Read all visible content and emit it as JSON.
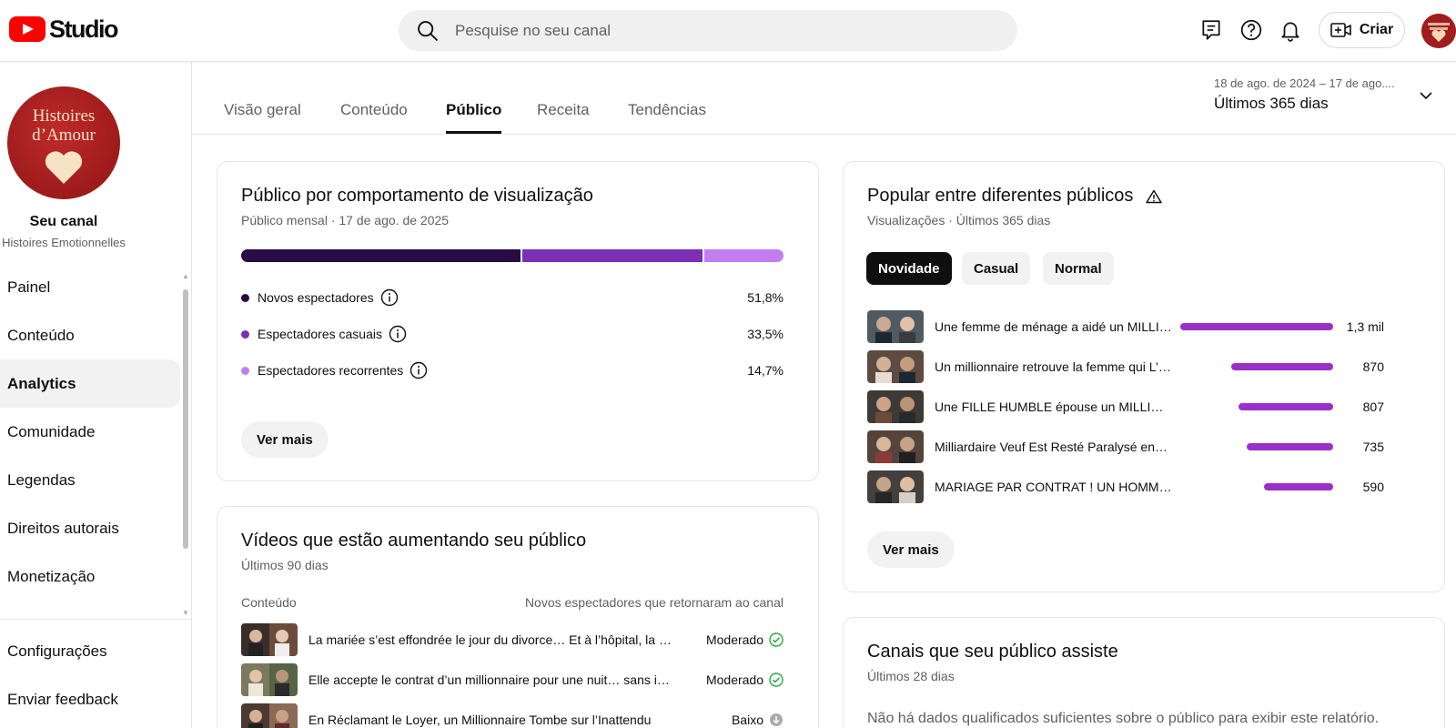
{
  "header": {
    "logo_text": "Studio",
    "search_placeholder": "Pesquise no seu canal",
    "create_label": "Criar",
    "icons": [
      "feedback-icon",
      "help-icon",
      "notifications-icon",
      "create-video-icon"
    ]
  },
  "sidebar": {
    "avatar_line1": "Histoires",
    "avatar_line2": "d’Amour",
    "your_channel": "Seu canal",
    "channel_name": "Histoires Emotionnelles",
    "items": [
      {
        "label": "Painel",
        "active": false
      },
      {
        "label": "Conteúdo",
        "active": false
      },
      {
        "label": "Analytics",
        "active": true
      },
      {
        "label": "Comunidade",
        "active": false
      },
      {
        "label": "Legendas",
        "active": false
      },
      {
        "label": "Direitos autorais",
        "active": false
      },
      {
        "label": "Monetização",
        "active": false
      }
    ],
    "bottom_items": [
      {
        "label": "Configurações"
      },
      {
        "label": "Enviar feedback"
      }
    ]
  },
  "tabs": [
    {
      "label": "Visão geral",
      "active": false
    },
    {
      "label": "Conteúdo",
      "active": false
    },
    {
      "label": "Público",
      "active": true
    },
    {
      "label": "Receita",
      "active": false
    },
    {
      "label": "Tendências",
      "active": false
    }
  ],
  "date_range": {
    "dates": "18 de ago. de 2024 – 17 de ago....",
    "label": "Últimos 365 dias"
  },
  "behavior_card": {
    "title": "Público por comportamento de visualização",
    "subtitle": "Público mensal · 17 de ago. de 2025",
    "segments": [
      {
        "label": "Novos espectadores",
        "value": "51,8%",
        "share": 51.8,
        "color": "#2b0b45"
      },
      {
        "label": "Espectadores casuais",
        "value": "33,5%",
        "share": 33.5,
        "color": "#7b2fb5"
      },
      {
        "label": "Espectadores recorrentes",
        "value": "14,7%",
        "share": 14.7,
        "color": "#c27ef0"
      }
    ],
    "button": "Ver mais"
  },
  "growing_card": {
    "title": "Vídeos que estão aumentando seu público",
    "subtitle": "Últimos 90 dias",
    "col_content": "Conteúdo",
    "col_metric": "Novos espectadores que retornaram ao canal",
    "rows": [
      {
        "title": "La mariée s’est effondrée le jour du divorce… Et à l’hôpital, la vérité…",
        "level": "Moderado",
        "status": "check"
      },
      {
        "title": "Elle accepte le contrat d’un millionnaire pour une nuit… sans imaginer…",
        "level": "Moderado",
        "status": "check"
      },
      {
        "title": "En Réclamant le Loyer, un Millionnaire Tombe sur l’Inattendu",
        "level": "Baixo",
        "status": "down"
      }
    ]
  },
  "popular_card": {
    "title": "Popular entre diferentes públicos",
    "subtitle": "Visualizações · Últimos 365 dias",
    "chips": [
      {
        "label": "Novidade",
        "active": true
      },
      {
        "label": "Casual",
        "active": false
      },
      {
        "label": "Normal",
        "active": false
      }
    ],
    "rows": [
      {
        "title": "Une femme de ménage a aidé un MILLIONNAIRE…",
        "value": "1,3 mil",
        "views": 1300
      },
      {
        "title": "Un millionnaire retrouve la femme qui L’avait…",
        "value": "870",
        "views": 870
      },
      {
        "title": "Une FILLE HUMBLE épouse un MILLIONNAIRE…",
        "value": "807",
        "views": 807
      },
      {
        "title": "Milliardaire Veuf Est Resté Paralysé en…",
        "value": "735",
        "views": 735
      },
      {
        "title": "MARIAGE PAR CONTRAT ! UN HOMME RICHE…",
        "value": "590",
        "views": 590
      }
    ],
    "bar_color": "#9b30c8",
    "button": "Ver mais"
  },
  "channels_card": {
    "title": "Canais que seu público assiste",
    "subtitle": "Últimos 28 dias",
    "message": "Não há dados qualificados suficientes sobre o público para exibir este relatório."
  }
}
